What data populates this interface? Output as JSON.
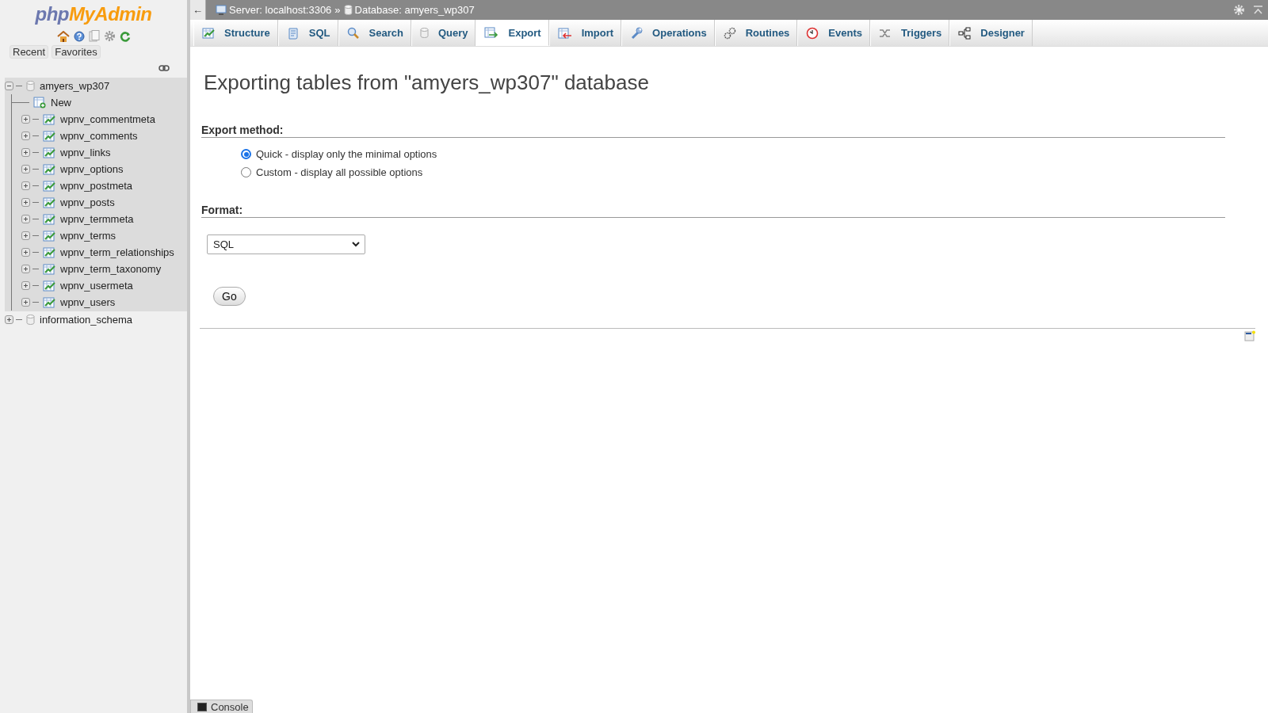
{
  "navigation": {
    "logo": {
      "part_1": "php",
      "part_2": "MyAdmin"
    },
    "quick_links": [
      "Recent",
      "Favorites"
    ],
    "tree": [
      {
        "label": "amyers_wp307",
        "kind": "database",
        "expanded": true,
        "children": [
          {
            "label": "New",
            "kind": "new"
          },
          {
            "label": "wpnv_commentmeta",
            "kind": "table",
            "expanded": false
          },
          {
            "label": "wpnv_comments",
            "kind": "table",
            "expanded": false
          },
          {
            "label": "wpnv_links",
            "kind": "table",
            "expanded": false
          },
          {
            "label": "wpnv_options",
            "kind": "table",
            "expanded": false
          },
          {
            "label": "wpnv_postmeta",
            "kind": "table",
            "expanded": false
          },
          {
            "label": "wpnv_posts",
            "kind": "table",
            "expanded": false
          },
          {
            "label": "wpnv_termmeta",
            "kind": "table",
            "expanded": false
          },
          {
            "label": "wpnv_terms",
            "kind": "table",
            "expanded": false
          },
          {
            "label": "wpnv_term_relationships",
            "kind": "table",
            "expanded": false
          },
          {
            "label": "wpnv_term_taxonomy",
            "kind": "table",
            "expanded": false
          },
          {
            "label": "wpnv_usermeta",
            "kind": "table",
            "expanded": false
          },
          {
            "label": "wpnv_users",
            "kind": "table",
            "expanded": false
          }
        ]
      },
      {
        "label": "information_schema",
        "kind": "database",
        "expanded": false
      }
    ]
  },
  "breadcrumb": {
    "back": "←",
    "server": "Server: localhost:3306",
    "separator": "»",
    "database": "Database: amyers_wp307"
  },
  "tabs": [
    {
      "label": "Structure",
      "selected": false
    },
    {
      "label": "SQL",
      "selected": false
    },
    {
      "label": "Search",
      "selected": false
    },
    {
      "label": "Query",
      "selected": false
    },
    {
      "label": "Export",
      "selected": true
    },
    {
      "label": "Import",
      "selected": false
    },
    {
      "label": "Operations",
      "selected": false
    },
    {
      "label": "Routines",
      "selected": false
    },
    {
      "label": "Events",
      "selected": false
    },
    {
      "label": "Triggers",
      "selected": false
    },
    {
      "label": "Designer",
      "selected": false
    }
  ],
  "page_title": "Exporting tables from \"amyers_wp307\" database",
  "export_method": {
    "heading": "Export method:",
    "options": [
      {
        "label": "Quick - display only the minimal options",
        "selected": true
      },
      {
        "label": "Custom - display all possible options",
        "selected": false
      }
    ]
  },
  "format": {
    "heading": "Format:",
    "value": "SQL"
  },
  "go_button": "Go",
  "console": "Console"
}
